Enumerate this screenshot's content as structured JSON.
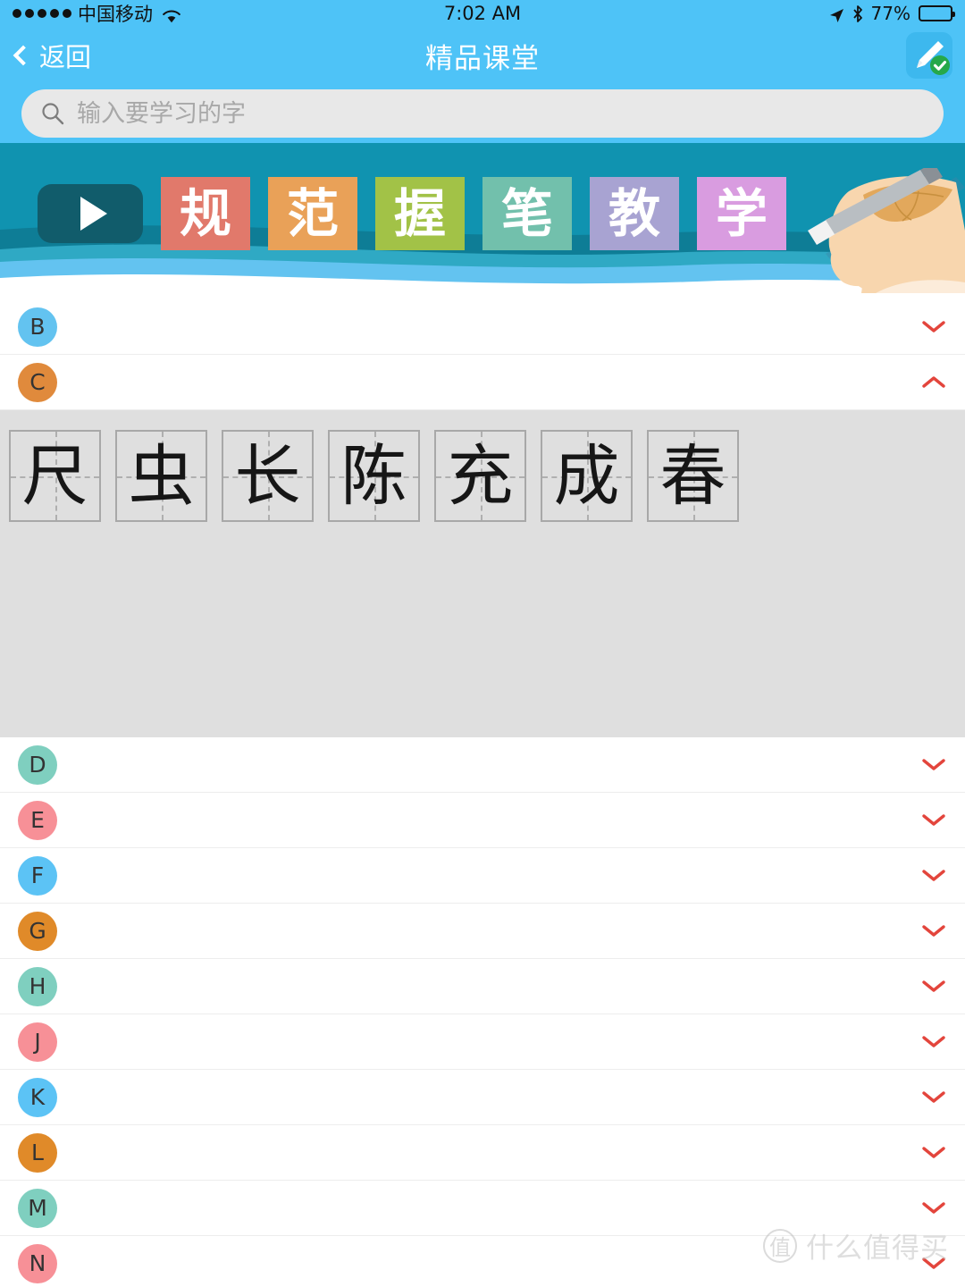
{
  "status_bar": {
    "signal_dots": 5,
    "carrier": "中国移动",
    "wifi_icon": "wifi-icon",
    "time": "7:02 AM",
    "location_icon": "location-arrow-icon",
    "bluetooth_icon": "bluetooth-icon",
    "battery_percent": "77%",
    "battery_level": 77
  },
  "nav_bar": {
    "back_label": "返回",
    "back_icon": "chevron-left-icon",
    "title": "精品课堂",
    "action_icon": "pen-edit-check-icon"
  },
  "search": {
    "icon": "search-icon",
    "value": "",
    "placeholder": "输入要学习的字"
  },
  "banner": {
    "background_color": "#1093B0",
    "play_button_icon": "play-icon",
    "tiles": [
      {
        "char": "规",
        "color": "#E1796B"
      },
      {
        "char": "范",
        "color": "#E9A158"
      },
      {
        "char": "握",
        "color": "#A2C martial"
      },
      {
        "char": "笔",
        "color": "#72C0AC"
      },
      {
        "char": "教",
        "color": "#A8A3D2"
      },
      {
        "char": "学",
        "color": "#D99CE0"
      }
    ],
    "wave_colors": [
      "#0E7D96",
      "#2FA9C4",
      "#63C3F0",
      "#FFFFFF"
    ],
    "hand_icon": "hand-writing-pen-illustration"
  },
  "letter_list": [
    {
      "letter": "B",
      "color": "#63C3F0",
      "expanded": false,
      "chevron": "chevron-down-icon"
    },
    {
      "letter": "C",
      "color": "#E08A3C",
      "expanded": true,
      "chevron": "chevron-up-icon"
    },
    {
      "letter": "D",
      "color": "#7FCFBF",
      "expanded": false,
      "chevron": "chevron-down-icon"
    },
    {
      "letter": "E",
      "color": "#F79097",
      "expanded": false,
      "chevron": "chevron-down-icon"
    },
    {
      "letter": "F",
      "color": "#5CC3F5",
      "expanded": false,
      "chevron": "chevron-down-icon"
    },
    {
      "letter": "G",
      "color": "#E08A29",
      "expanded": false,
      "chevron": "chevron-down-icon"
    },
    {
      "letter": "H",
      "color": "#7FCFBF",
      "expanded": false,
      "chevron": "chevron-down-icon"
    },
    {
      "letter": "J",
      "color": "#F79097",
      "expanded": false,
      "chevron": "chevron-down-icon"
    },
    {
      "letter": "K",
      "color": "#5CC3F5",
      "expanded": false,
      "chevron": "chevron-down-icon"
    },
    {
      "letter": "L",
      "color": "#E08A29",
      "expanded": false,
      "chevron": "chevron-down-icon"
    },
    {
      "letter": "M",
      "color": "#7FCFBF",
      "expanded": false,
      "chevron": "chevron-down-icon"
    },
    {
      "letter": "N",
      "color": "#F79097",
      "expanded": false,
      "chevron": "chevron-down-icon"
    }
  ],
  "expanded_section": {
    "letter": "C",
    "background_color": "#DFDFDF",
    "chevron_color": "#E3453C",
    "characters": [
      "尺",
      "虫",
      "长",
      "陈",
      "充",
      "成",
      "春"
    ]
  },
  "watermark": {
    "logo_char": "值",
    "text": "什么值得买"
  }
}
